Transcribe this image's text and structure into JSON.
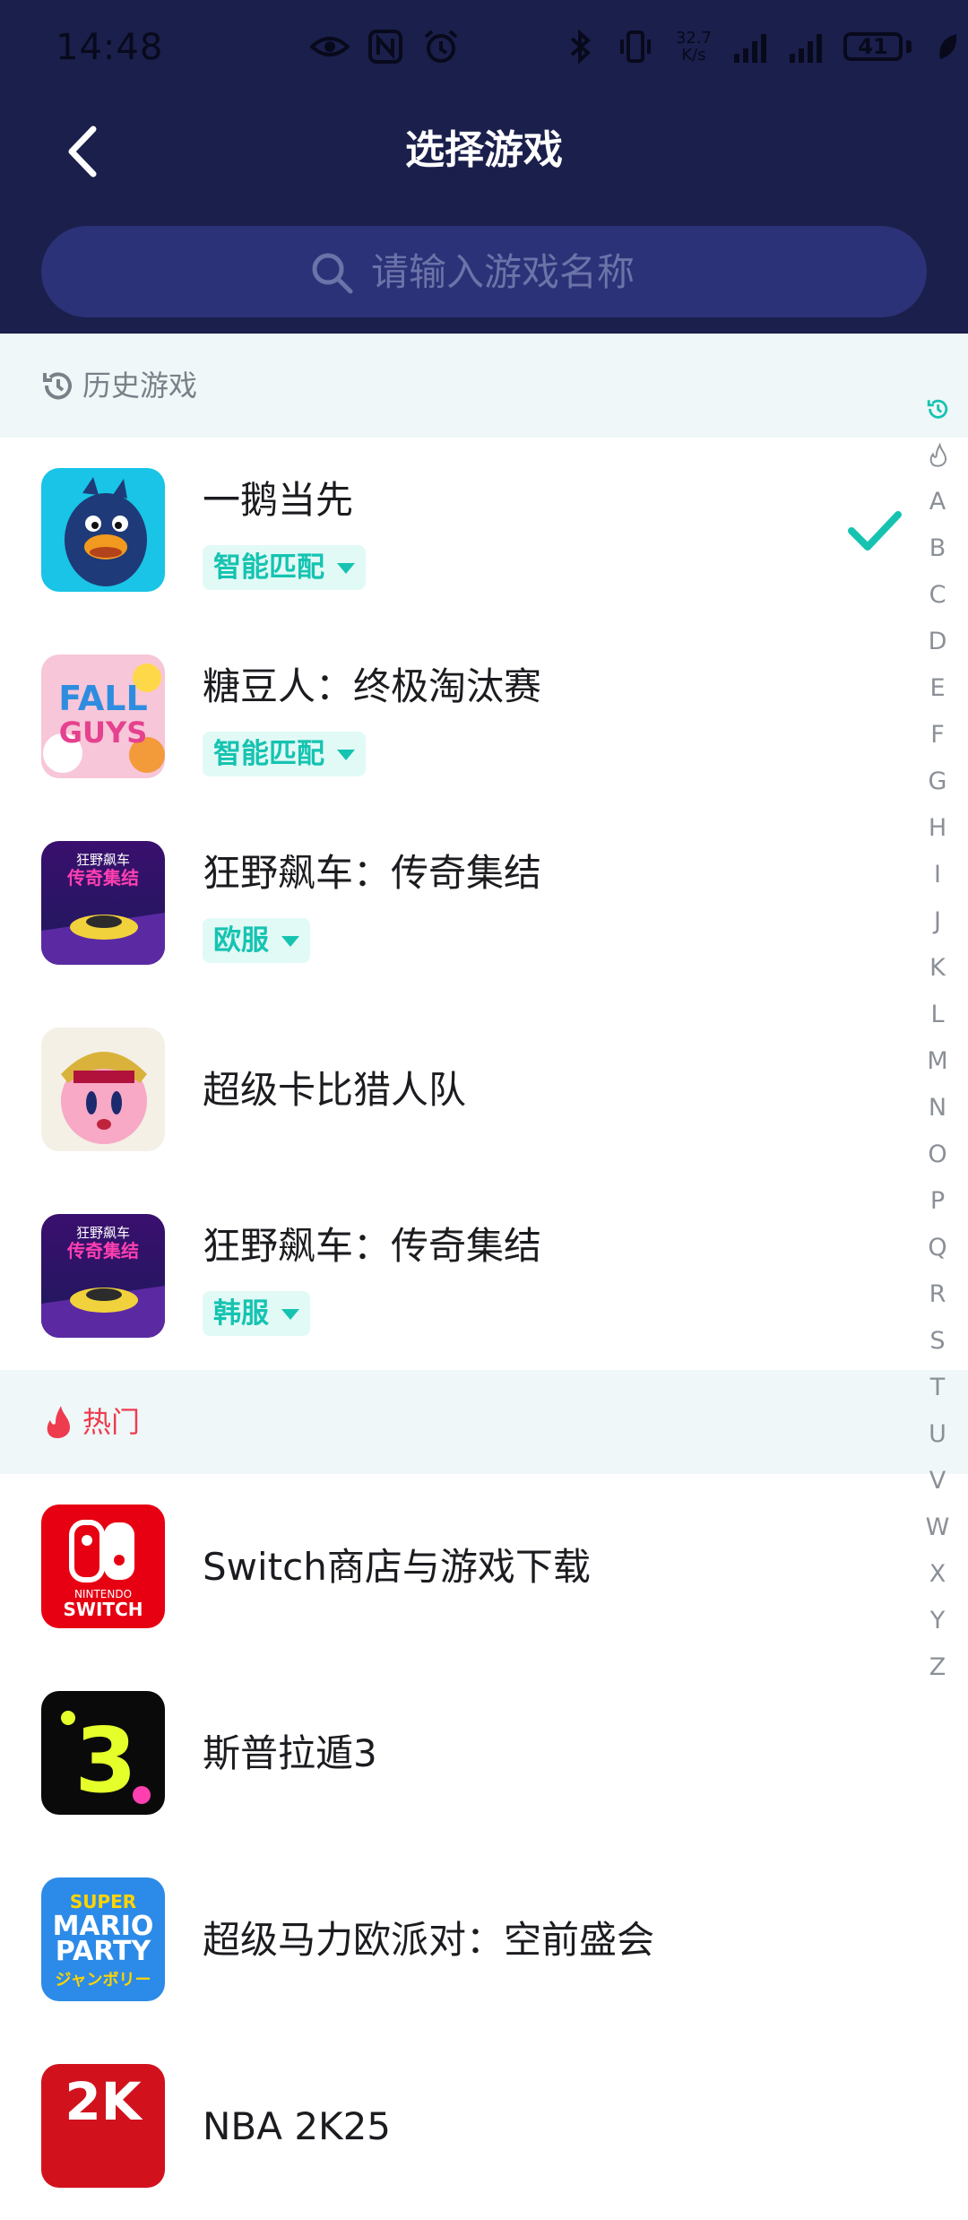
{
  "status_bar": {
    "time": "14:48",
    "net_speed_value": "32.7",
    "net_speed_unit": "K/s",
    "battery": "41"
  },
  "header": {
    "title": "选择游戏",
    "search_placeholder": "请输入游戏名称"
  },
  "sections": {
    "history": {
      "label": "历史游戏"
    },
    "hot": {
      "label": "热门"
    }
  },
  "history_games": [
    {
      "name": "一鹅当先",
      "tag": "智能匹配",
      "selected": true
    },
    {
      "name": "糖豆人：终极淘汰赛",
      "tag": "智能匹配"
    },
    {
      "name": "狂野飙车：传奇集结",
      "tag": "欧服"
    },
    {
      "name": "超级卡比猎人队"
    },
    {
      "name": "狂野飙车：传奇集结",
      "tag": "韩服"
    }
  ],
  "hot_games": [
    {
      "name": "Switch商店与游戏下载"
    },
    {
      "name": "斯普拉遁3"
    },
    {
      "name": "超级马力欧派对：空前盛会"
    },
    {
      "name": "NBA 2K25"
    }
  ],
  "icon_text": {
    "fall_guys_1": "FALL",
    "fall_guys_2": "GUYS",
    "asphalt_logo": "狂野飙车",
    "asphalt_sub": "传奇集结",
    "nintendo": "NINTENDO",
    "switch": "SWITCH",
    "splatoon": "3",
    "mario_1": "SUPER",
    "mario_2": "MARIO",
    "mario_3": "PARTY",
    "mario_4": "ジャンボリー",
    "nba": "2K"
  },
  "index_letters": [
    "A",
    "B",
    "C",
    "D",
    "E",
    "F",
    "G",
    "H",
    "I",
    "J",
    "K",
    "L",
    "M",
    "N",
    "O",
    "P",
    "Q",
    "R",
    "S",
    "T",
    "U",
    "V",
    "W",
    "X",
    "Y",
    "Z"
  ],
  "colors": {
    "header_bg": "#1b1f4b",
    "search_bg": "#2b3277",
    "accent_teal": "#16c3b1",
    "hot_red": "#ee3b4e",
    "section_bg": "#eff7f8"
  }
}
